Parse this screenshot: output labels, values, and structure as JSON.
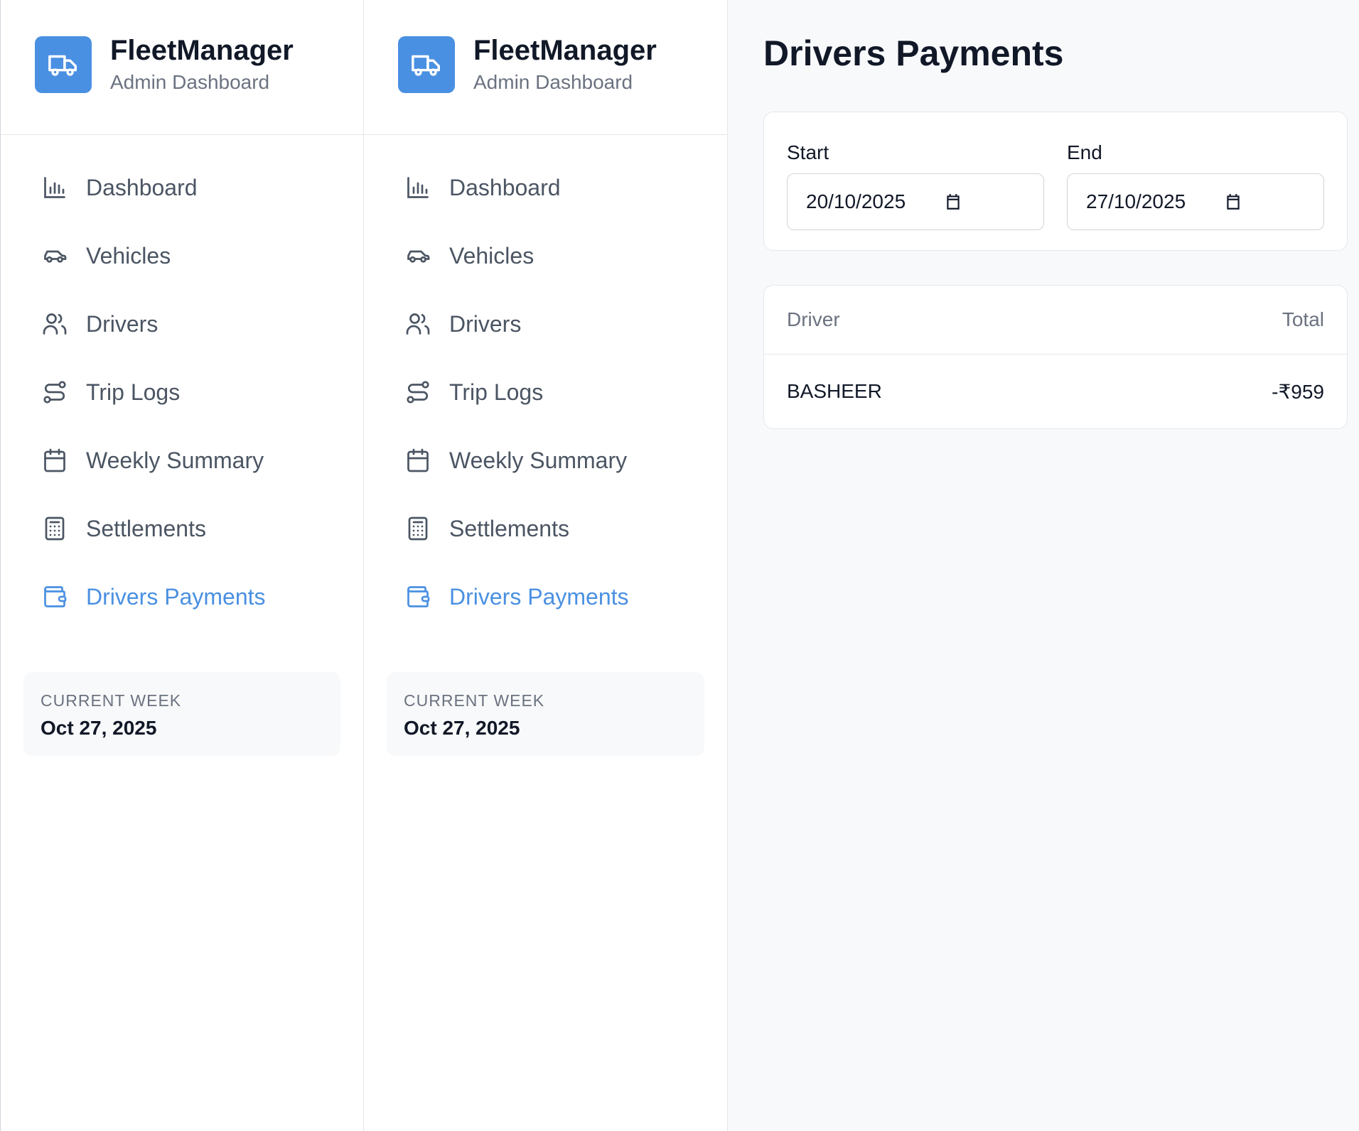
{
  "brand": {
    "name": "FleetManager",
    "subtitle": "Admin Dashboard"
  },
  "nav": {
    "items": [
      {
        "label": "Dashboard",
        "icon": "bar-chart-icon",
        "active": false
      },
      {
        "label": "Vehicles",
        "icon": "car-icon",
        "active": false
      },
      {
        "label": "Drivers",
        "icon": "users-icon",
        "active": false
      },
      {
        "label": "Trip Logs",
        "icon": "route-icon",
        "active": false
      },
      {
        "label": "Weekly Summary",
        "icon": "calendar-icon",
        "active": false
      },
      {
        "label": "Settlements",
        "icon": "calculator-icon",
        "active": false
      },
      {
        "label": "Drivers Payments",
        "icon": "wallet-icon",
        "active": true
      }
    ]
  },
  "week": {
    "label": "CURRENT WEEK",
    "value": "Oct 27, 2025"
  },
  "page": {
    "title": "Drivers Payments"
  },
  "filters": {
    "start_label": "Start",
    "start_value": "20/10/2025",
    "end_label": "End",
    "end_value": "27/10/2025"
  },
  "table": {
    "headers": [
      "Driver",
      "Total"
    ],
    "rows": [
      {
        "driver": "BASHEER",
        "total": "-₹959"
      }
    ]
  },
  "colors": {
    "accent": "#4a90e2",
    "text": "#111827",
    "muted": "#6b7280",
    "background": "#f8f9fb"
  }
}
